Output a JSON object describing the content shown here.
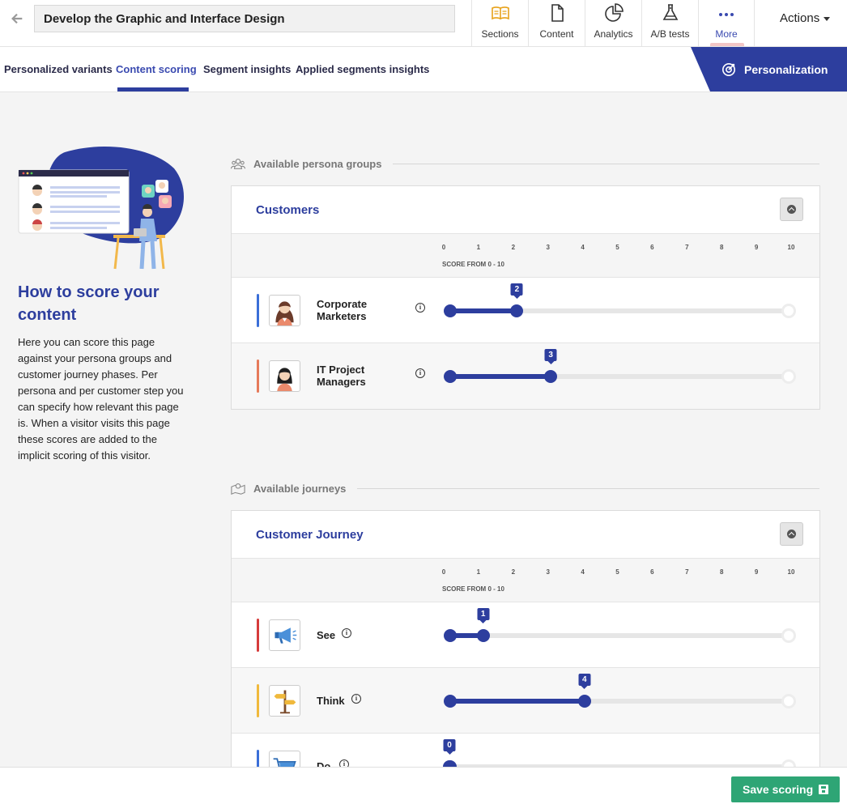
{
  "header": {
    "title_value": "Develop the Graphic and Interface Design",
    "tabs": [
      {
        "label": "Sections",
        "icon": "book-open-icon"
      },
      {
        "label": "Content",
        "icon": "document-icon"
      },
      {
        "label": "Analytics",
        "icon": "pie-chart-icon"
      },
      {
        "label": "A/B tests",
        "icon": "flask-icon"
      },
      {
        "label": "More",
        "icon": "more-dots-icon"
      }
    ],
    "actions_label": "Actions"
  },
  "subnav": {
    "tabs": [
      "Personalized variants",
      "Content scoring",
      "Segment insights",
      "Applied segments insights"
    ],
    "active_tab": "Content scoring",
    "personalization_label": "Personalization"
  },
  "howto": {
    "title": "How to score your content",
    "text": "Here you can score this page against your persona groups and customer journey phases. Per persona and per customer step you can specify how relevant this page is. When a visitor visits this page these scores are added to the implicit scoring of this visitor."
  },
  "personas_section": {
    "heading": "Available persona groups",
    "panel_title": "Customers",
    "scale_caption": "SCORE FROM 0 - 10",
    "ticks": [
      "0",
      "1",
      "2",
      "3",
      "4",
      "5",
      "6",
      "7",
      "8",
      "9",
      "10"
    ],
    "rows": [
      {
        "label": "Corporate Marketers",
        "score": 2,
        "color": "#3a6fd8"
      },
      {
        "label": "IT Project Managers",
        "score": 3,
        "color": "#e67a5a"
      }
    ]
  },
  "journeys_section": {
    "heading": "Available journeys",
    "panel_title": "Customer Journey",
    "scale_caption": "SCORE FROM 0 - 10",
    "ticks": [
      "0",
      "1",
      "2",
      "3",
      "4",
      "5",
      "6",
      "7",
      "8",
      "9",
      "10"
    ],
    "rows": [
      {
        "label": "See",
        "score": 1,
        "color": "#d63b3b"
      },
      {
        "label": "Think",
        "score": 4,
        "color": "#f0b93c"
      },
      {
        "label": "Do",
        "score": 0,
        "color": "#3a6fd8"
      }
    ]
  },
  "footer": {
    "save_label": "Save scoring"
  },
  "colors": {
    "primary": "#2d3e9e",
    "save_button": "#2ea575"
  }
}
